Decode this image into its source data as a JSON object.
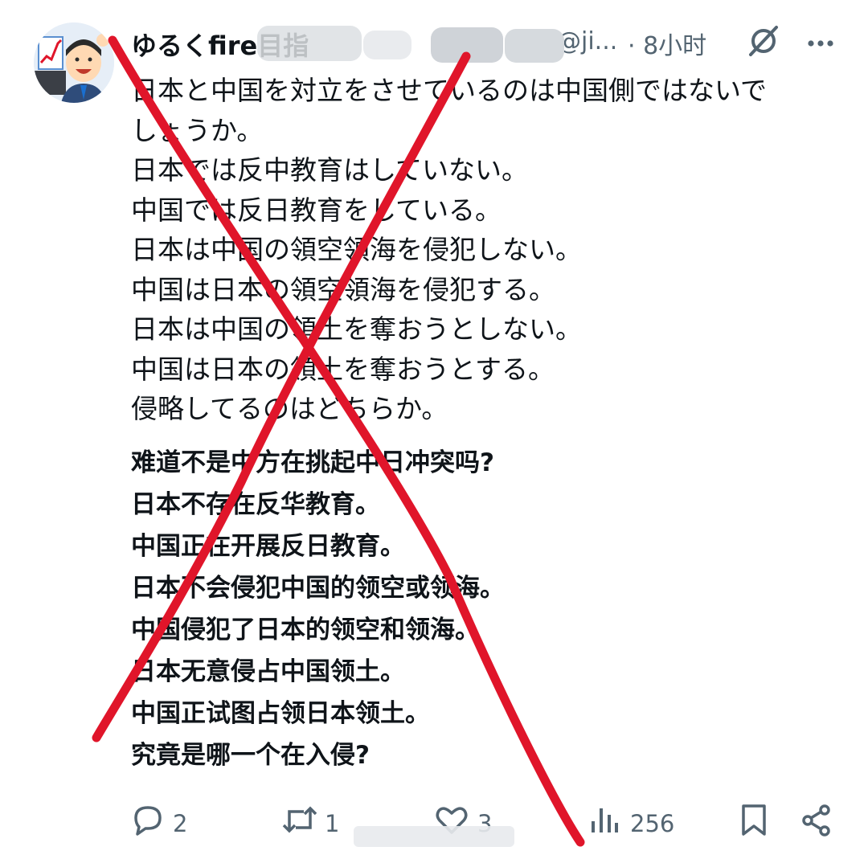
{
  "post": {
    "display_name": "ゆるくfire目指",
    "handle": "@ji...",
    "time": "· 8小时",
    "body_japanese": [
      "日本と中国を対立をさせているのは中国側ではないで",
      "しょうか。",
      "日本では反中教育はしていない。",
      "中国では反日教育をしている。",
      "日本は中国の領空領海を侵犯しない。",
      "中国は日本の領空領海を侵犯する。",
      "日本は中国の領土を奪おうとしない。",
      "中国は日本の領土を奪おうとする。",
      "侵略してるのはどちらか。"
    ],
    "body_chinese": [
      "难道不是中方在挑起中日冲突吗?",
      "日本不存在反华教育。",
      "中国正在开展反日教育。",
      "日本不会侵犯中国的领空或领海。",
      "中国侵犯了日本的领空和领海。",
      "日本无意侵占中国领土。",
      "中国正试图占领日本领土。",
      "究竟是哪一个在入侵?"
    ]
  },
  "actions": {
    "replies": "2",
    "reposts": "1",
    "likes": "3",
    "views": "256"
  },
  "icons": {
    "reply": "reply-icon",
    "repost": "repost-icon",
    "like": "heart-icon",
    "views": "views-icon",
    "bookmark": "bookmark-icon",
    "share": "share-icon",
    "grok": "grok-icon",
    "more": "more-icon"
  },
  "colors": {
    "text": "#0f1419",
    "secondary": "#536471",
    "strike": "#e0152a"
  }
}
